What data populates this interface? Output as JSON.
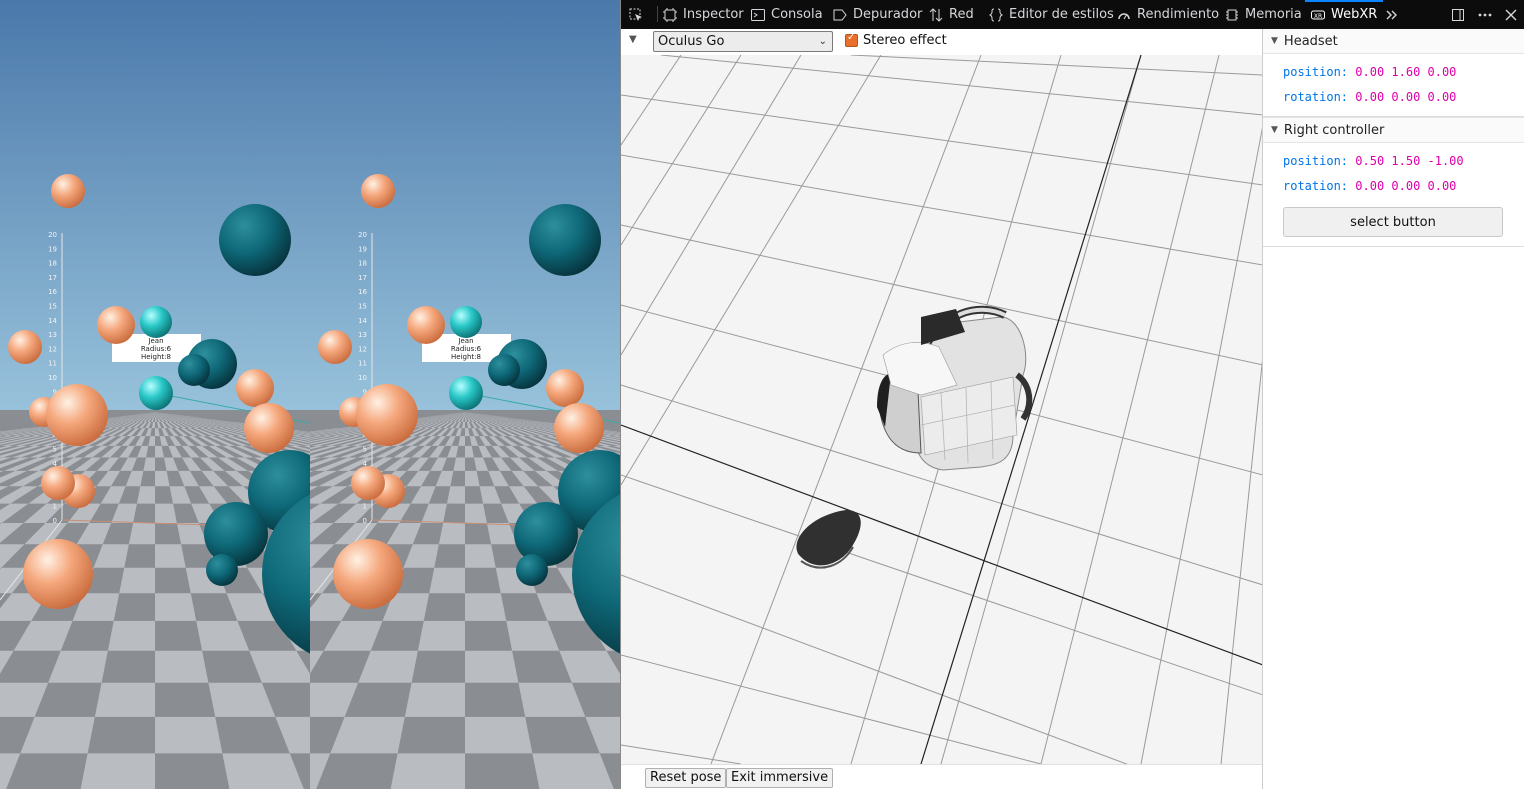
{
  "toolbar": {
    "tabs": [
      {
        "label": "Inspector",
        "icon": "inspector-icon"
      },
      {
        "label": "Consola",
        "icon": "console-icon"
      },
      {
        "label": "Depurador",
        "icon": "debugger-icon"
      },
      {
        "label": "Red",
        "icon": "network-icon"
      },
      {
        "label": "Editor de estilos",
        "icon": "style-editor-icon"
      },
      {
        "label": "Rendimiento",
        "icon": "performance-icon"
      },
      {
        "label": "Memoria",
        "icon": "memory-icon"
      },
      {
        "label": "WebXR",
        "icon": "webxr-icon",
        "active": true
      }
    ]
  },
  "emulator": {
    "device": "Oculus Go",
    "stereo_label": "Stereo effect",
    "stereo_checked": true,
    "reset_label": "Reset pose",
    "exit_label": "Exit immersive"
  },
  "panel": {
    "headset": {
      "title": "Headset",
      "position_key": "position:",
      "position_val": "0.00 1.60 0.00",
      "rotation_key": "rotation:",
      "rotation_val": "0.00 0.00 0.00"
    },
    "controller": {
      "title": "Right controller",
      "position_key": "position:",
      "position_val": "0.50 1.50 -1.00",
      "rotation_key": "rotation:",
      "rotation_val": "0.00 0.00 0.00",
      "button_label": "select button"
    }
  },
  "scene_label": {
    "name": "Jean",
    "radius": "Radius:6",
    "height": "Height:8"
  },
  "axis_ticks": [
    "20",
    "19",
    "18",
    "17",
    "16",
    "15",
    "14",
    "13",
    "12",
    "11",
    "10",
    "9",
    "8",
    "7",
    "6",
    "5",
    "4",
    "3",
    "2",
    "1",
    "0"
  ],
  "colors": {
    "sky_top": "#4a78aa",
    "sky_bottom": "#9ac4dc",
    "salmon": "#f5a77c",
    "teal": "#0e6878",
    "cyan": "#2ac8c8",
    "accent": "#0a84ff"
  }
}
